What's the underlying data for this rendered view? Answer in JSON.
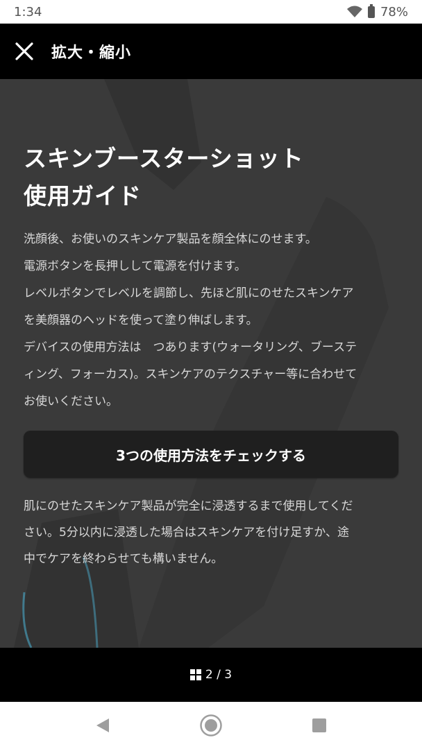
{
  "status_bar": {
    "time": "1:34",
    "battery": "78%",
    "icons": [
      "wifi-icon",
      "battery-icon"
    ]
  },
  "header": {
    "close_icon": "close-icon",
    "title": "拡大・縮小"
  },
  "guide": {
    "title_lines": [
      "スキンブースターショット",
      "使用ガイド"
    ],
    "body_lines": [
      "洗顔後、お使いのスキンケア製品を顔全体にのせます。",
      "電源ボタンを長押しして電源を付けます。",
      "レベルボタンでレベルを調節し、先ほど肌にのせたスキンケア",
      "を美顔器のヘッドを使って塗り伸ばします。",
      "デバイスの使用方法は　つあります(ウォータリング、ブーステ",
      "ィング、フォーカス)。スキンケアのテクスチャー等に合わせて",
      "お使いください。"
    ],
    "check_button_label": "3つの使用方法をチェックする",
    "note_lines": [
      "肌にのせたスキンケア製品が完全に浸透するまで使用してくだ",
      "さい。5分以内に浸透した場合はスキンケアを付け足すか、途",
      "中でケアを終わらせても構いません。"
    ]
  },
  "footer": {
    "pages_icon": "grid-icon",
    "page_indicator": "2 / 3"
  },
  "nav_bar": {
    "icons": [
      "back-icon",
      "home-icon",
      "recents-icon"
    ]
  },
  "colors": {
    "background": "#000000",
    "content_bg": "#3a3a3a",
    "button_bg": "#1f1f1f",
    "text": "#ffffff",
    "body_text": "#d8d8d8"
  }
}
